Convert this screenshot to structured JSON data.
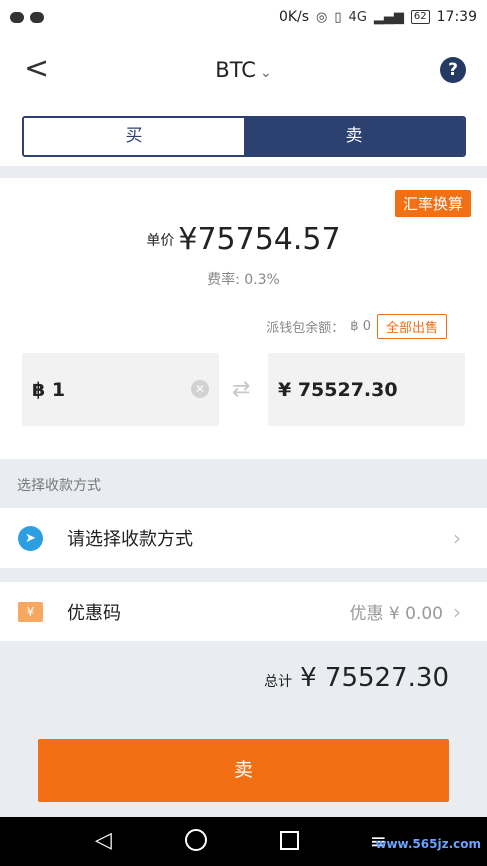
{
  "statusbar": {
    "net_speed": "0K/s",
    "signal": "4G",
    "battery": "62",
    "time": "17:39"
  },
  "header": {
    "back_glyph": "<",
    "title": "BTC",
    "chevron": "⌄",
    "help": "?"
  },
  "tabs": {
    "buy": "买",
    "sell": "卖"
  },
  "quote": {
    "fx_button": "汇率换算",
    "price_label": "单价",
    "price": "¥75754.57",
    "fee": "费率: 0.3%",
    "wallet_label": "派钱包余额：",
    "wallet_value": "฿ 0",
    "sell_all": "全部出售"
  },
  "inputs": {
    "btc_value": "฿ 1",
    "cny_value": "¥ 75527.30",
    "swap": "⇄"
  },
  "payment": {
    "section_label": "选择收款方式",
    "placeholder": "请选择收款方式"
  },
  "coupon": {
    "label": "优惠码",
    "discount": "优惠 ¥ 0.00"
  },
  "total": {
    "label": "总计",
    "value": "¥ 75527.30"
  },
  "submit": {
    "label": "卖"
  },
  "watermark": "www.565jz.com"
}
